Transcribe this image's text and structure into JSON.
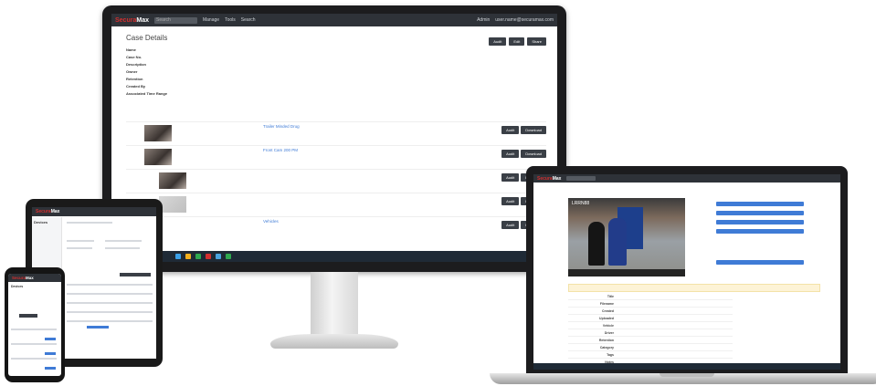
{
  "brand": {
    "name_prefix": "Secura",
    "name_suffix": "Max",
    "accent": "#d32f2f",
    "link_color": "#3f7bd6",
    "dark_bar": "#2e3238"
  },
  "monitor": {
    "topbar": {
      "search_placeholder": "Search",
      "nav": [
        "Manage",
        "Tools",
        "Search"
      ],
      "right_user": "Admin",
      "right_email": "user.name@securamax.com"
    },
    "page_title": "Case Details",
    "actions": [
      "Audit",
      "Edit",
      "Share"
    ],
    "fields": [
      {
        "label": "Name"
      },
      {
        "label": "Case No."
      },
      {
        "label": "Description"
      },
      {
        "label": "Owner"
      },
      {
        "label": "Retention"
      },
      {
        "label": "Created By"
      },
      {
        "label": "Associated Time Range"
      }
    ],
    "items": [
      {
        "title": "Trailer Minded Drug",
        "btn1": "Audit",
        "btn2": "Download"
      },
      {
        "title": "Front Cam 200 PM",
        "btn1": "Audit",
        "btn2": "Download"
      },
      {
        "title": "",
        "btn1": "Audit",
        "btn2": "Download"
      },
      {
        "title": "",
        "btn1": "Audit",
        "btn2": "Download"
      },
      {
        "title": "Vehicles",
        "btn1": "Audit",
        "btn2": "Download"
      }
    ]
  },
  "laptop": {
    "video_label": "LRRN88",
    "side_buttons": [
      "",
      "",
      "",
      "",
      ""
    ],
    "warning": "",
    "meta_keys": [
      "Title",
      "Filename",
      "Created",
      "Uploaded",
      "Vehicle",
      "Driver",
      "Retention",
      "Category",
      "Tags",
      "Notes"
    ]
  },
  "tablet": {
    "title": "Devices"
  },
  "phone": {
    "title": "Devices"
  }
}
